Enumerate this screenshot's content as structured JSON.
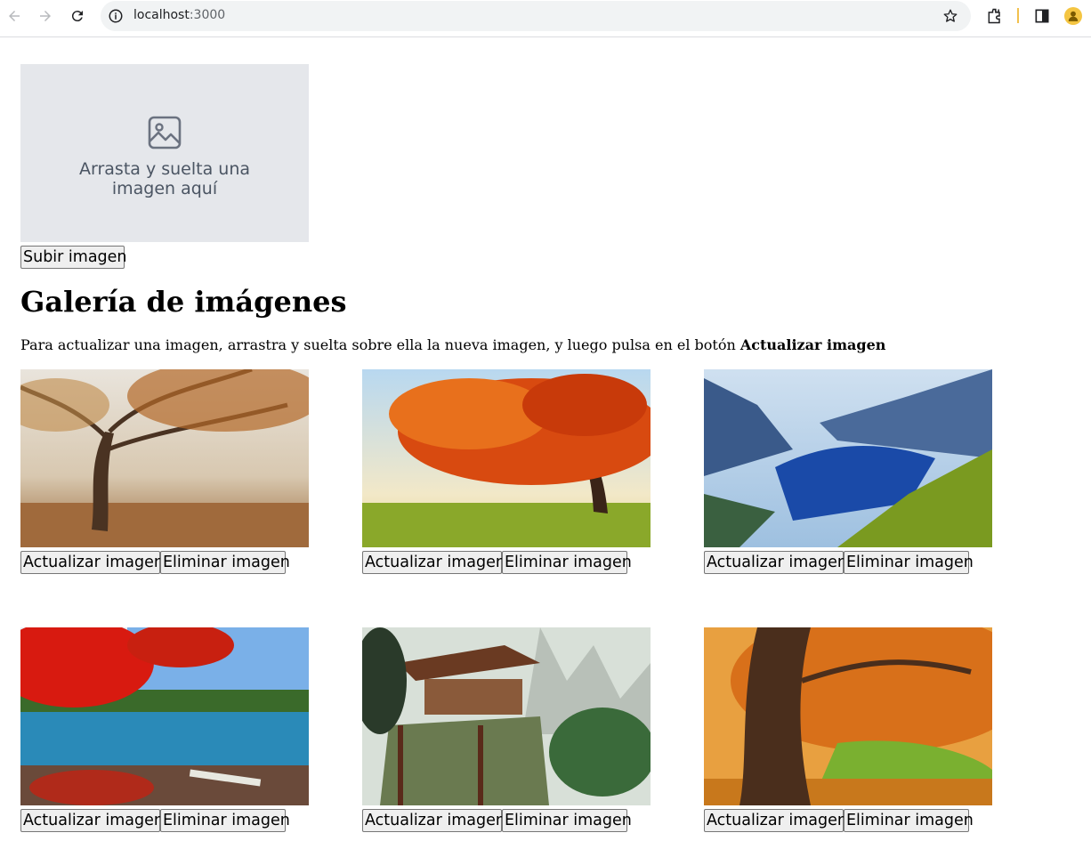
{
  "browser": {
    "url_host": "localhost",
    "url_port": ":3000"
  },
  "dropzone": {
    "text": "Arrasta y suelta una imagen aquí"
  },
  "upload_button": "Subir imagen",
  "gallery": {
    "title": "Galería de imágenes",
    "instructions_prefix": "Para actualizar una imagen, arrastra y suelta sobre ella la nueva imagen, y luego pulsa en el botón ",
    "instructions_bold": "Actualizar imagen",
    "items": [
      {
        "update_label": "Actualizar imagen",
        "delete_label": "Eliminar imagen"
      },
      {
        "update_label": "Actualizar imagen",
        "delete_label": "Eliminar imagen"
      },
      {
        "update_label": "Actualizar imagen",
        "delete_label": "Eliminar imagen"
      },
      {
        "update_label": "Actualizar imagen",
        "delete_label": "Eliminar imagen"
      },
      {
        "update_label": "Actualizar imagen",
        "delete_label": "Eliminar imagen"
      },
      {
        "update_label": "Actualizar imagen",
        "delete_label": "Eliminar imagen"
      }
    ]
  }
}
